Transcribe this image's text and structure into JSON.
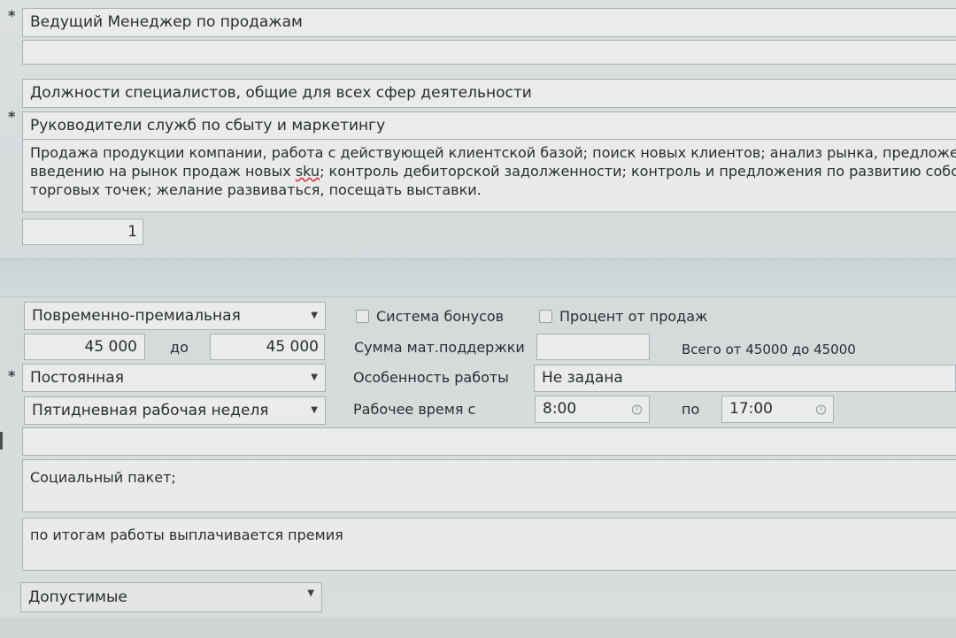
{
  "header": {
    "position_title": "Ведущий Менеджер по продажам",
    "empty_field": "",
    "category": "Должности специалистов, общие для всех сфер деятельности",
    "subcategory": "Руководители служб по сбыту и маркетингу",
    "duties_lines": [
      "Продажа продукции компании, работа с действующей клиентской базой; поиск новых клиентов; анализ рынка, предложени",
      "введению на рынок продаж новых ",
      "sku",
      "; контроль дебиторской задолженности; контроль и предложения по развитию собств",
      "торговых точек; желание развиваться, посещать выставки."
    ],
    "count_value": "1"
  },
  "salary": {
    "pay_system": "Повременно-премиальная",
    "bonus_system_label": "Система бонусов",
    "percent_of_sales_label": "Процент от продаж",
    "salary_from": "45 000",
    "to_label": "до",
    "salary_to": "45 000",
    "support_sum_label": "Сумма мат.поддержки",
    "support_sum_value": "",
    "total_range": "Всего от 45000 до 45000",
    "employment_type": "Постоянная",
    "work_feature_label": "Особенность работы",
    "work_feature_value": "Не задана",
    "schedule": "Пятидневная рабочая неделя",
    "work_time_label": "Рабочее время с",
    "time_from": "8:00",
    "time_to_label": "по",
    "time_to": "17:00"
  },
  "extras": {
    "empty_row": "",
    "social_package": "Социальный пакет;",
    "bonus_note": "по итогам работы выплачивается премия",
    "admissible": "Допустимые"
  },
  "icons": {
    "dropdown": "▼"
  }
}
